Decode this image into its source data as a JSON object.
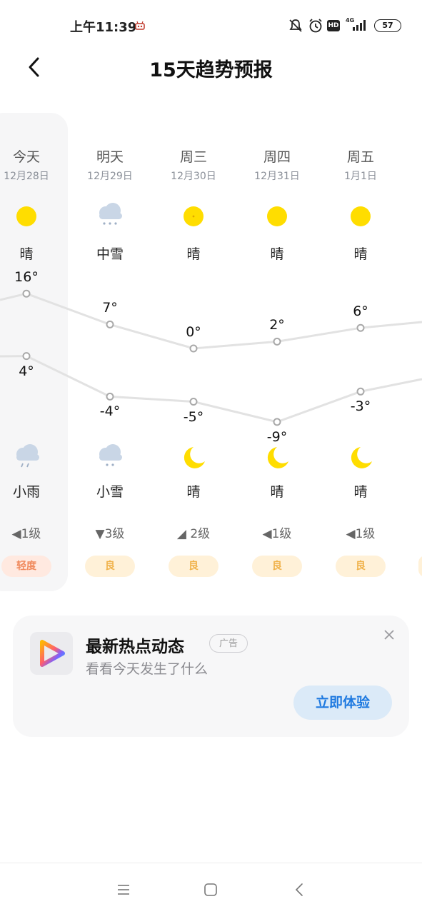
{
  "status_bar": {
    "time": "上午11:39",
    "hd_label": "HD",
    "network_label": "4G",
    "battery": "57"
  },
  "header": {
    "title": "15天趋势预报"
  },
  "forecast": {
    "days": [
      {
        "name": "今天",
        "date": "12月28日",
        "day_cond": "晴",
        "day_icon": "sun-icon",
        "high": "16°",
        "low": "4°",
        "night_cond": "小雨",
        "night_icon": "light-rain-icon",
        "wind": "◀1级",
        "aqi": "轻度"
      },
      {
        "name": "明天",
        "date": "12月29日",
        "day_cond": "中雪",
        "day_icon": "moderate-snow-icon",
        "high": "7°",
        "low": "-4°",
        "night_cond": "小雪",
        "night_icon": "light-snow-icon",
        "wind": "▼3级",
        "aqi": "良"
      },
      {
        "name": "周三",
        "date": "12月30日",
        "day_cond": "晴",
        "day_icon": "sun-icon",
        "high": "0°",
        "low": "-5°",
        "night_cond": "晴",
        "night_icon": "moon-icon",
        "wind": "◢ 2级",
        "aqi": "良"
      },
      {
        "name": "周四",
        "date": "12月31日",
        "day_cond": "晴",
        "day_icon": "sun-icon",
        "high": "2°",
        "low": "-9°",
        "night_cond": "晴",
        "night_icon": "moon-icon",
        "wind": "◀1级",
        "aqi": "良"
      },
      {
        "name": "周五",
        "date": "1月1日",
        "day_cond": "晴",
        "day_icon": "sun-icon",
        "high": "6°",
        "low": "-3°",
        "night_cond": "晴",
        "night_icon": "moon-icon",
        "wind": "◀1级",
        "aqi": "良"
      }
    ],
    "high_temps": [
      16,
      7,
      0,
      2,
      6
    ],
    "low_temps": [
      4,
      -4,
      -5,
      -9,
      -3
    ]
  },
  "ad": {
    "title": "最新热点动态",
    "tag": "广告",
    "subtitle": "看看今天发生了什么",
    "cta": "立即体验"
  },
  "colors": {
    "sun": "#FFDD00",
    "cloud": "#C9D6E6",
    "line": "#E2E2E2",
    "aqi_good_bg": "#FFF1D8",
    "aqi_good_text": "#F0B24A",
    "aqi_light_bg": "#FFE9E0",
    "aqi_light_text": "#F08A5D",
    "cta_bg": "#DBEAF8",
    "cta_text": "#1F7AE0"
  }
}
